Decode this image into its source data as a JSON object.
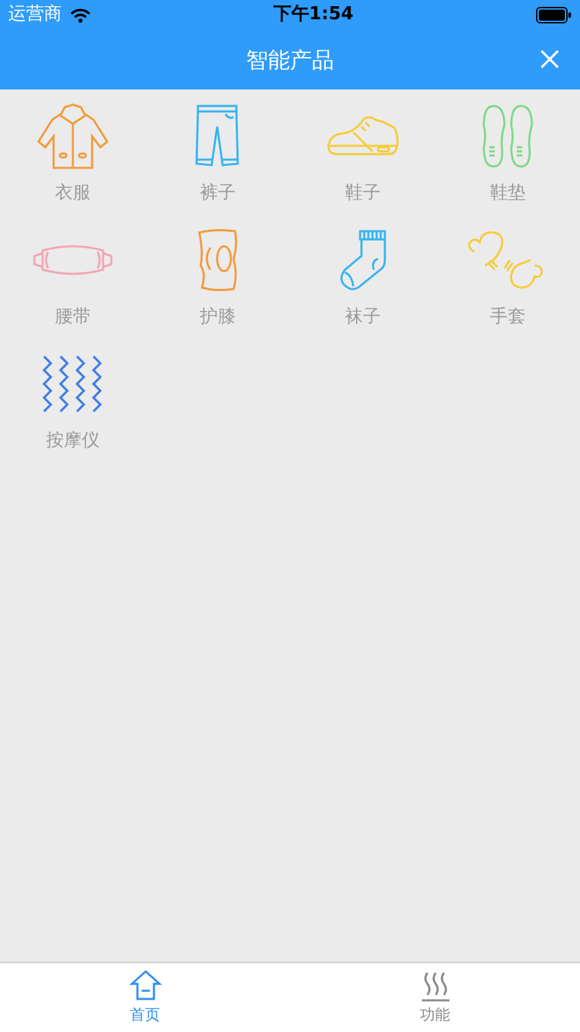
{
  "status_bar": {
    "carrier": "运营商",
    "time": "下午1:54"
  },
  "nav_bar": {
    "title": "智能产品"
  },
  "products": [
    {
      "kind": "coat",
      "label": "衣服"
    },
    {
      "kind": "pants",
      "label": "裤子"
    },
    {
      "kind": "shoe",
      "label": "鞋子"
    },
    {
      "kind": "insole",
      "label": "鞋垫"
    },
    {
      "kind": "belt",
      "label": "腰带"
    },
    {
      "kind": "knee",
      "label": "护膝"
    },
    {
      "kind": "sock",
      "label": "袜子"
    },
    {
      "kind": "glove",
      "label": "手套"
    },
    {
      "kind": "massager",
      "label": "按摩仪"
    }
  ],
  "tab_bar": [
    {
      "kind": "home",
      "label": "首页",
      "selected": true
    },
    {
      "kind": "heat",
      "label": "功能",
      "selected": false
    }
  ]
}
